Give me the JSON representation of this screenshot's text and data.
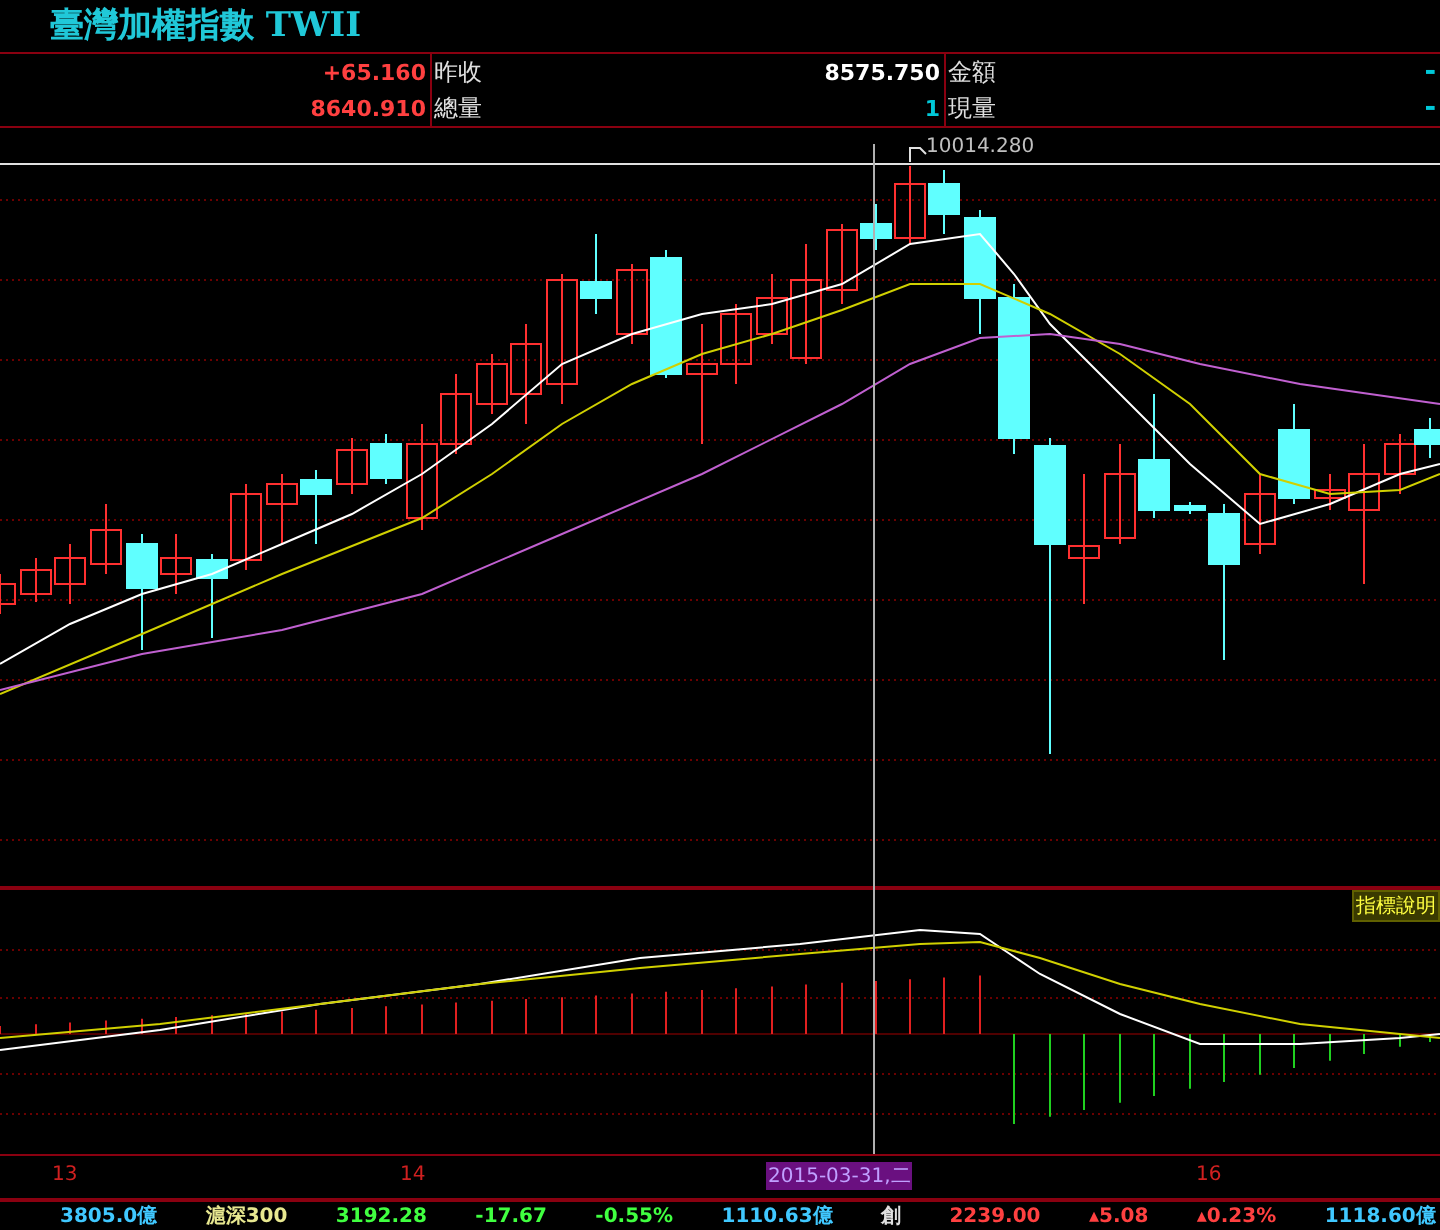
{
  "title": "臺灣加權指數 TWII",
  "quote_rows": [
    {
      "cells": [
        {
          "value": "+65.160",
          "color": "#ff4040",
          "label": "昨收"
        },
        {
          "value": "8575.750",
          "color": "#ffffff",
          "label": "金額"
        },
        {
          "value": "-",
          "color": "#00c8d8"
        }
      ]
    },
    {
      "cells": [
        {
          "value": "8640.910",
          "color": "#ff4040",
          "label": "總量"
        },
        {
          "value": "1",
          "color": "#00c8d8",
          "label": "現量"
        },
        {
          "value": "-",
          "color": "#00c8d8"
        }
      ]
    }
  ],
  "chart": {
    "high_label": "10014.280",
    "indicator_button": "指標說明",
    "axis_labels": [
      {
        "text": "13",
        "selected": false
      },
      {
        "text": "14",
        "selected": false
      },
      {
        "text": "2015-03-31,二",
        "selected": true
      },
      {
        "text": "16",
        "selected": false
      }
    ]
  },
  "ticker": [
    {
      "text": "3805.0億",
      "color": "#40c8ff"
    },
    {
      "text": "滬深300",
      "color": "#e8e890"
    },
    {
      "text": "3192.28",
      "color": "#40ff40"
    },
    {
      "text": "-17.67",
      "color": "#40ff40"
    },
    {
      "text": "-0.55%",
      "color": "#40ff40"
    },
    {
      "text": "1110.63億",
      "color": "#40c8ff"
    },
    {
      "text": "創",
      "color": "#e0e0e0"
    },
    {
      "text": "2239.00",
      "color": "#ff4040"
    },
    {
      "text": "▴5.08",
      "color": "#ff4040"
    },
    {
      "text": "▴0.23%",
      "color": "#ff4040"
    },
    {
      "text": "1118.60億",
      "color": "#40c8ff"
    }
  ]
}
